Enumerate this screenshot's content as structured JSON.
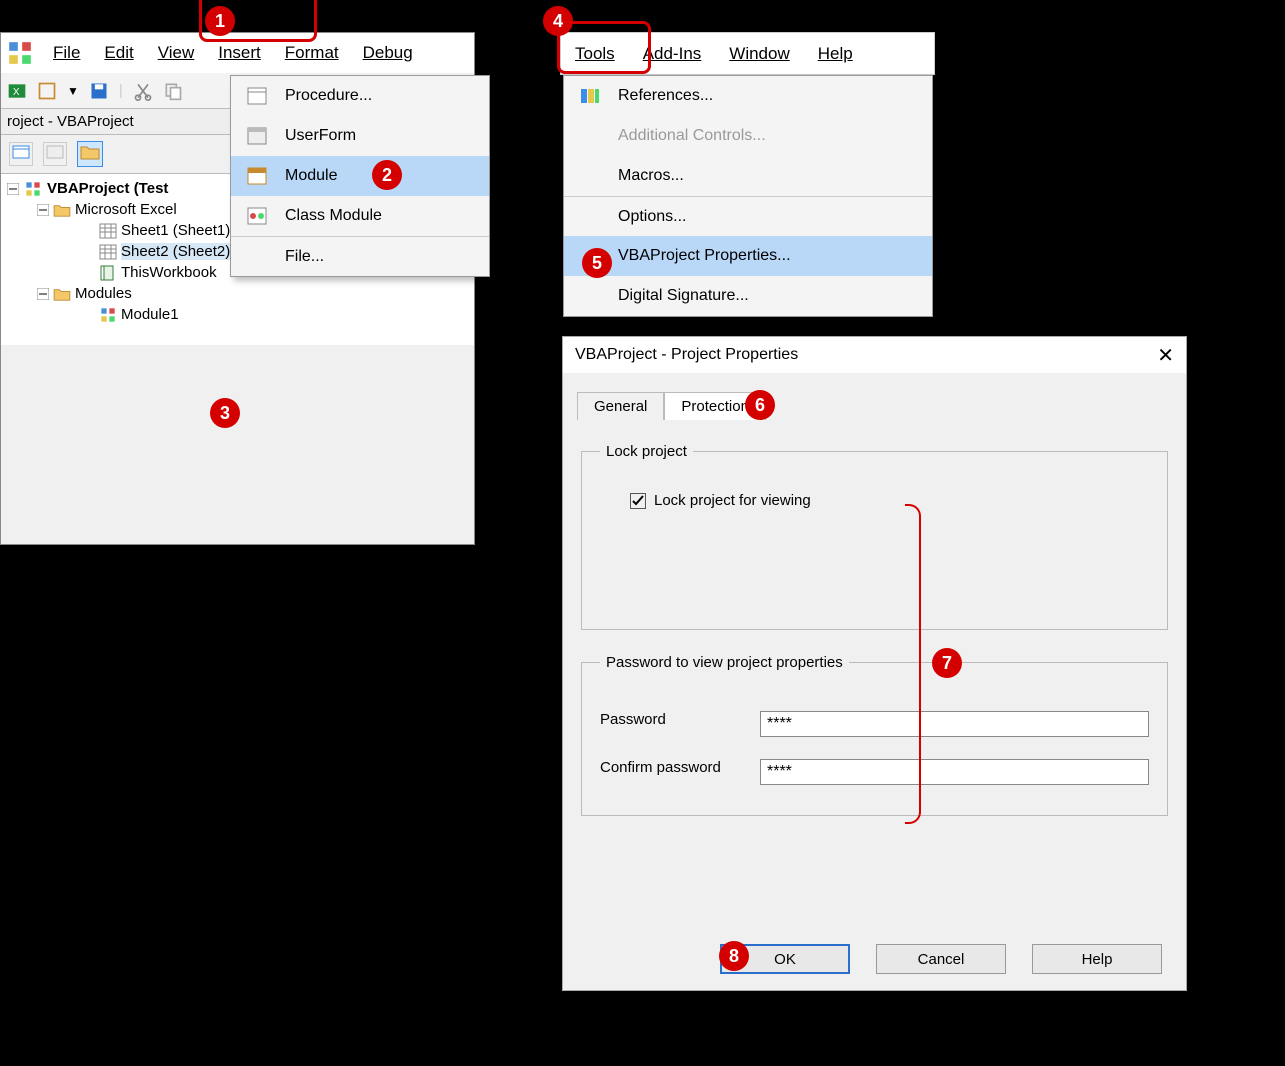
{
  "menubar_left": {
    "file": "File",
    "edit": "Edit",
    "view": "View",
    "insert": "Insert",
    "format": "Format",
    "debug": "Debug"
  },
  "menubar_right": {
    "tools": "Tools",
    "addins": "Add-Ins",
    "window": "Window",
    "help": "Help"
  },
  "project_panel": {
    "header": "roject - VBAProject",
    "root": "VBAProject (Test",
    "excel_objects": "Microsoft Excel",
    "sheet1": "Sheet1 (Sheet1)",
    "sheet2": "Sheet2 (Sheet2)",
    "thiswb": "ThisWorkbook",
    "modules": "Modules",
    "module1": "Module1"
  },
  "insert_menu": {
    "procedure": "Procedure...",
    "userform": "UserForm",
    "module": "Module",
    "classmodule": "Class Module",
    "file": "File..."
  },
  "tools_menu": {
    "references": "References...",
    "additional": "Additional Controls...",
    "macros": "Macros...",
    "options": "Options...",
    "props": "VBAProject Properties...",
    "dsig": "Digital Signature..."
  },
  "dialog": {
    "title": "VBAProject - Project Properties",
    "tab_general": "General",
    "tab_protection": "Protection",
    "lock_legend": "Lock project",
    "lock_label": "Lock project for viewing",
    "lock_checked": true,
    "pw_legend": "Password to view project properties",
    "pw_label": "Password",
    "cpw_label": "Confirm password",
    "pw_value": "****",
    "cpw_value": "****",
    "ok": "OK",
    "cancel": "Cancel",
    "help": "Help"
  },
  "callouts": {
    "c1": "1",
    "c2": "2",
    "c3": "3",
    "c4": "4",
    "c5": "5",
    "c6": "6",
    "c7": "7",
    "c8": "8"
  }
}
